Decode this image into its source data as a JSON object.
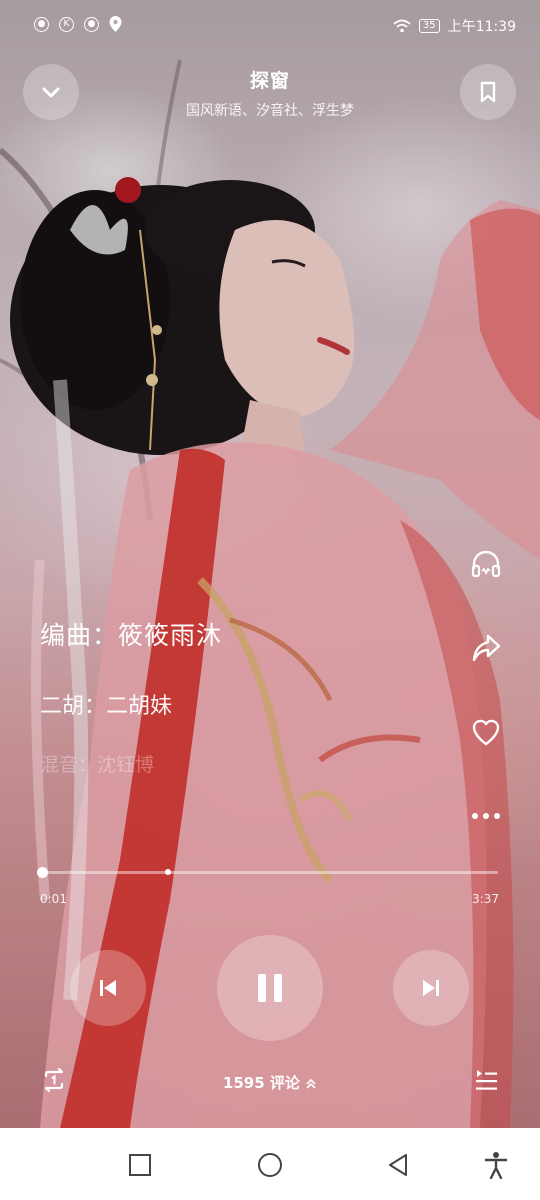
{
  "status_bar": {
    "icons": [
      "record-icon",
      "k-icon",
      "record-icon",
      "location-icon"
    ],
    "k_label": "K",
    "battery": "35",
    "time": "上午11:39"
  },
  "header": {
    "title": "探窗",
    "artist": "国风新语、汐音社、浮生梦"
  },
  "lyrics": {
    "line1": "编曲：筱筱雨沐",
    "line2": "二胡：二胡妹",
    "line3": "混音：沈钰博"
  },
  "side_actions": [
    "headphones-icon",
    "share-icon",
    "heart-icon",
    "more-icon"
  ],
  "player": {
    "current_time": "0:01",
    "total_time": "3:37",
    "progress_fraction": 0.005,
    "buffer_fraction": 0.28
  },
  "footer": {
    "comments_label": "1595 评论",
    "repeat_icon": "repeat-one-icon",
    "playlist_icon": "playlist-icon"
  },
  "navbar": [
    "recent-apps-icon",
    "home-icon",
    "back-icon",
    "accessibility-icon"
  ]
}
